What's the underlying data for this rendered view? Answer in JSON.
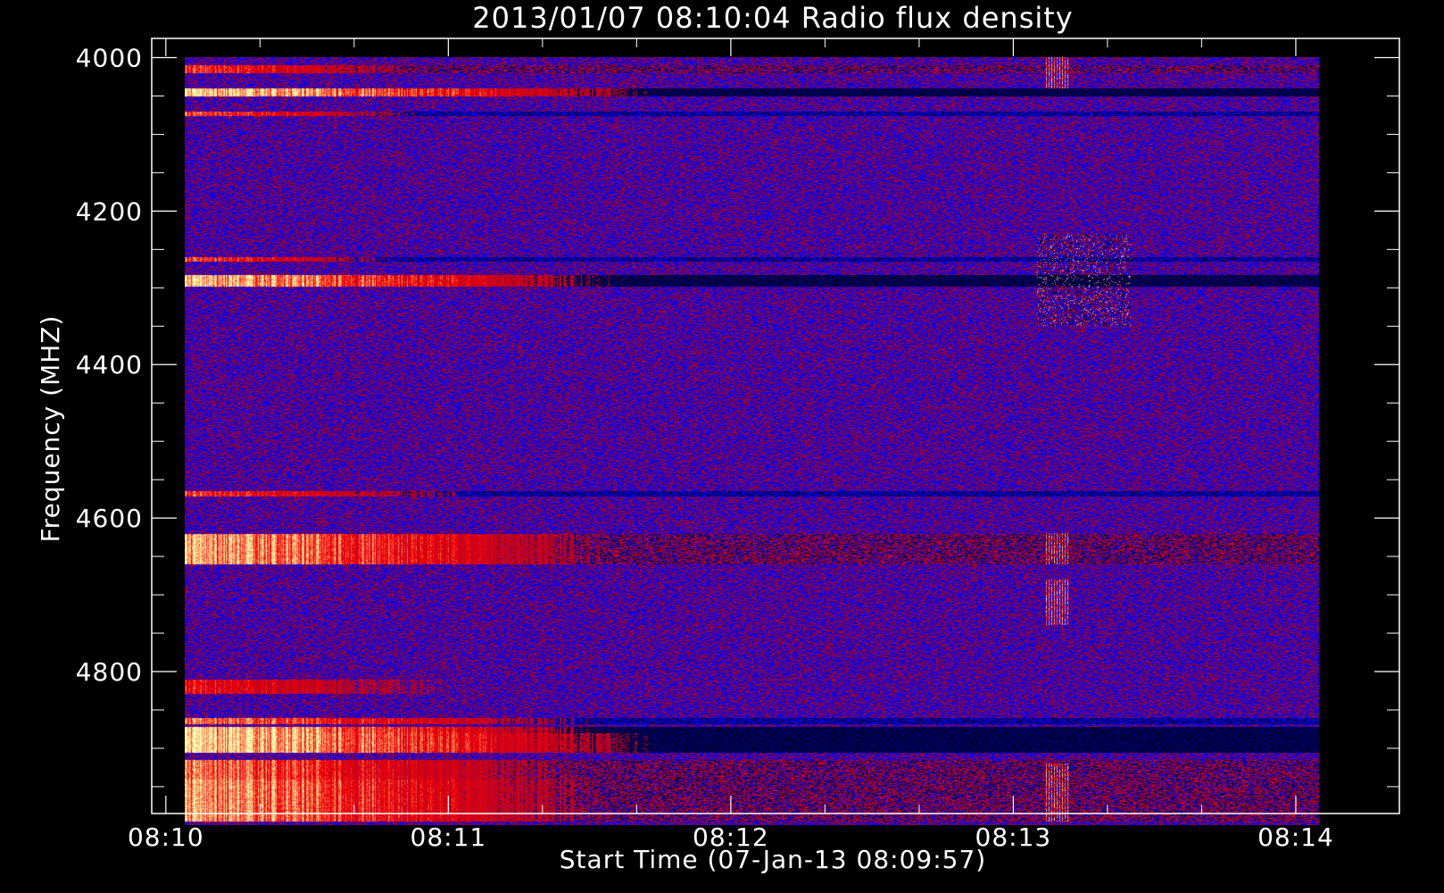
{
  "chart_data": {
    "type": "heatmap",
    "title": "2013/01/07 08:10:04 Radio flux density",
    "xlabel": "Start Time (07-Jan-13 08:09:57)",
    "ylabel": "Frequency (MHZ)",
    "x_range": [
      "08:09:57",
      "08:14:22"
    ],
    "y_range": [
      3975,
      4985
    ],
    "y_inverted": true,
    "data_x_range": [
      "08:10:04",
      "08:14:05"
    ],
    "data_y_range": [
      4000,
      5000
    ],
    "x_ticks": [
      "08:10",
      "08:11",
      "08:12",
      "08:13",
      "08:14"
    ],
    "y_ticks": [
      4000,
      4200,
      4400,
      4600,
      4800
    ],
    "colormap": [
      "#0000ff",
      "#000000",
      "#ff0000",
      "#ffff99"
    ],
    "background_color": "#0000ff",
    "bands": [
      {
        "f1": 4040,
        "f2": 4051,
        "fade": 0.45,
        "peak": 1.0,
        "late": "black"
      },
      {
        "f1": 4010,
        "f2": 4020,
        "fade": 0.25,
        "peak": 0.55,
        "late": "mix"
      },
      {
        "f1": 4070,
        "f2": 4076,
        "fade": 0.25,
        "peak": 0.6,
        "late": "dark"
      },
      {
        "f1": 4260,
        "f2": 4266,
        "fade": 0.22,
        "peak": 0.6,
        "late": "dark"
      },
      {
        "f1": 4283,
        "f2": 4298,
        "fade": 0.42,
        "peak": 0.9,
        "late": "black"
      },
      {
        "f1": 4565,
        "f2": 4572,
        "fade": 0.3,
        "peak": 0.55,
        "late": "dark"
      },
      {
        "f1": 4620,
        "f2": 4660,
        "fade": 0.42,
        "peak": 0.85,
        "late": "mix"
      },
      {
        "f1": 4810,
        "f2": 4828,
        "fade": 0.3,
        "peak": 0.45,
        "late": "none"
      },
      {
        "f1": 4860,
        "f2": 4868,
        "fade": 0.42,
        "peak": 0.7,
        "late": "dark"
      },
      {
        "f1": 4872,
        "f2": 4880,
        "fade": 0.4,
        "peak": 1.0,
        "late": "black"
      },
      {
        "f1": 4880,
        "f2": 4905,
        "fade": 0.45,
        "peak": 1.0,
        "late": "black"
      },
      {
        "f1": 4915,
        "f2": 4940,
        "fade": 0.4,
        "peak": 0.7,
        "late": "mix"
      },
      {
        "f1": 4940,
        "f2": 4995,
        "fade": 0.42,
        "peak": 0.8,
        "late": "mix"
      }
    ],
    "bursts": [
      {
        "t1": "08:13:05",
        "t2": "08:13:25",
        "f1": 4230,
        "f2": 4350,
        "kind": "speckle"
      },
      {
        "t1": "08:13:07",
        "t2": "08:13:12",
        "f1": 4000,
        "f2": 4040,
        "kind": "stripe"
      },
      {
        "t1": "08:13:07",
        "t2": "08:13:12",
        "f1": 4620,
        "f2": 4660,
        "kind": "stripe"
      },
      {
        "t1": "08:13:07",
        "t2": "08:13:12",
        "f1": 4680,
        "f2": 4740,
        "kind": "stripe"
      },
      {
        "t1": "08:13:07",
        "t2": "08:13:12",
        "f1": 4920,
        "f2": 4995,
        "kind": "stripe"
      }
    ]
  }
}
